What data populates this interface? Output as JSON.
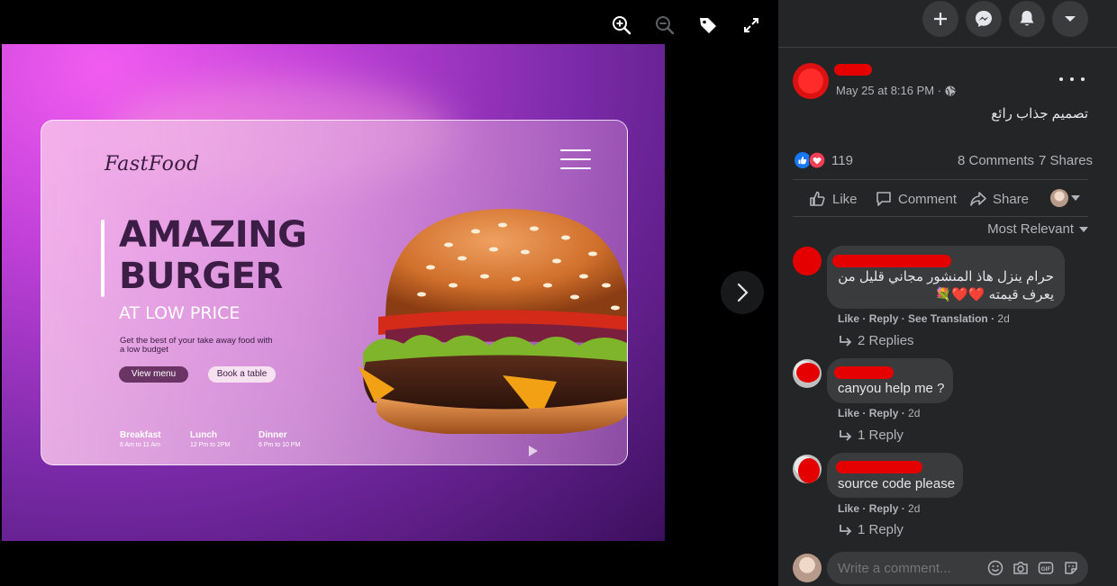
{
  "viewer": {
    "tools": [
      "zoom-in-icon",
      "zoom-out-icon",
      "tag-icon",
      "fullscreen-icon"
    ],
    "photo": {
      "brand": "FastFood",
      "headline_1": "AMAZING",
      "headline_2": "BURGER",
      "subheadline": "AT LOW PRICE",
      "tagline": "Get the best of your take away food with a low budget",
      "button_primary": "View menu",
      "button_secondary": "Book a table",
      "meals": [
        {
          "name": "Breakfast",
          "hours": "6 Am to 11 Am"
        },
        {
          "name": "Lunch",
          "hours": "12 Pm to 2PM"
        },
        {
          "name": "Dinner",
          "hours": "6 Pm to 10 PM"
        }
      ]
    }
  },
  "post": {
    "timestamp": "May 25 at 8:16 PM ·",
    "text": "تصميم جذاب رائع",
    "reaction_count": "119",
    "comments_count": "8 Comments",
    "shares_count": "7 Shares",
    "actions": {
      "like": "Like",
      "comment": "Comment",
      "share": "Share"
    },
    "sort_label": "Most Relevant"
  },
  "comments": [
    {
      "line1": "حرام ينزل هاذ المنشور مجاني قليل من",
      "line2": "يعرف قيمته ❤️❤️💐",
      "like": "Like",
      "reply": "Reply",
      "translate": "See Translation",
      "age": "2d",
      "replies": "2 Replies"
    },
    {
      "line1": "canyou help me ?",
      "like": "Like",
      "reply": "Reply",
      "age": "2d",
      "replies": "1 Reply"
    },
    {
      "line1": "source code please",
      "like": "Like",
      "reply": "Reply",
      "age": "2d",
      "replies": "1 Reply"
    }
  ],
  "composer": {
    "placeholder": "Write a comment..."
  },
  "colors": {
    "panel_bg": "#242526",
    "bubble_bg": "#3a3b3c",
    "text": "#e4e6eb",
    "muted": "#b0b3b8",
    "like_blue": "#1877f2",
    "love_red": "#f33e58"
  }
}
